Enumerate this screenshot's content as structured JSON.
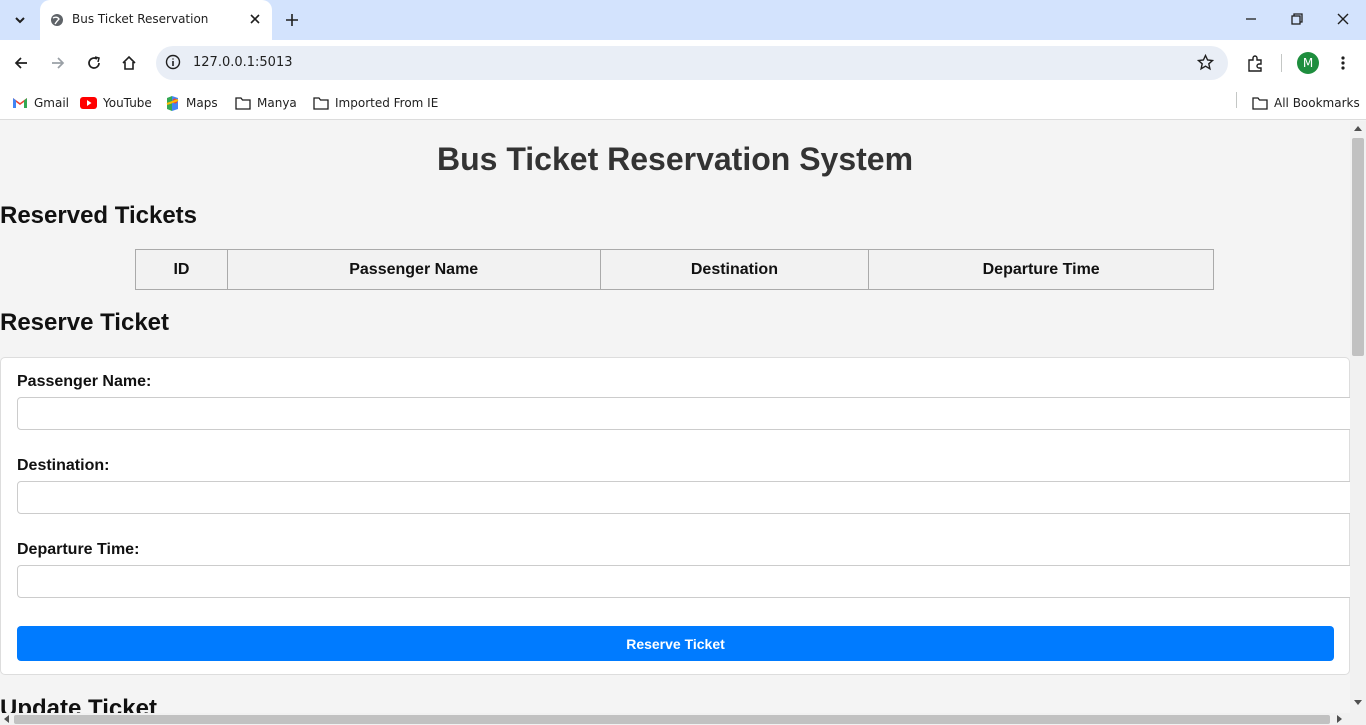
{
  "browser": {
    "tab_title": "Bus Ticket Reservation",
    "url": "127.0.0.1:5013",
    "profile_initial": "M",
    "bookmarks": [
      "Gmail",
      "YouTube",
      "Maps",
      "Manya",
      "Imported From IE"
    ],
    "all_bookmarks": "All Bookmarks"
  },
  "page": {
    "title": "Bus Ticket Reservation System",
    "reserved_heading": "Reserved Tickets",
    "table_headers": [
      "ID",
      "Passenger Name",
      "Destination",
      "Departure Time"
    ],
    "reserve_heading": "Reserve Ticket",
    "form": {
      "passenger_label": "Passenger Name:",
      "destination_label": "Destination:",
      "departure_label": "Departure Time:",
      "submit_label": "Reserve Ticket"
    },
    "update_heading": "Update Ticket"
  },
  "colors": {
    "accent": "#007bff",
    "tabbar": "#d3e3fd",
    "page_bg": "#f4f4f4"
  }
}
